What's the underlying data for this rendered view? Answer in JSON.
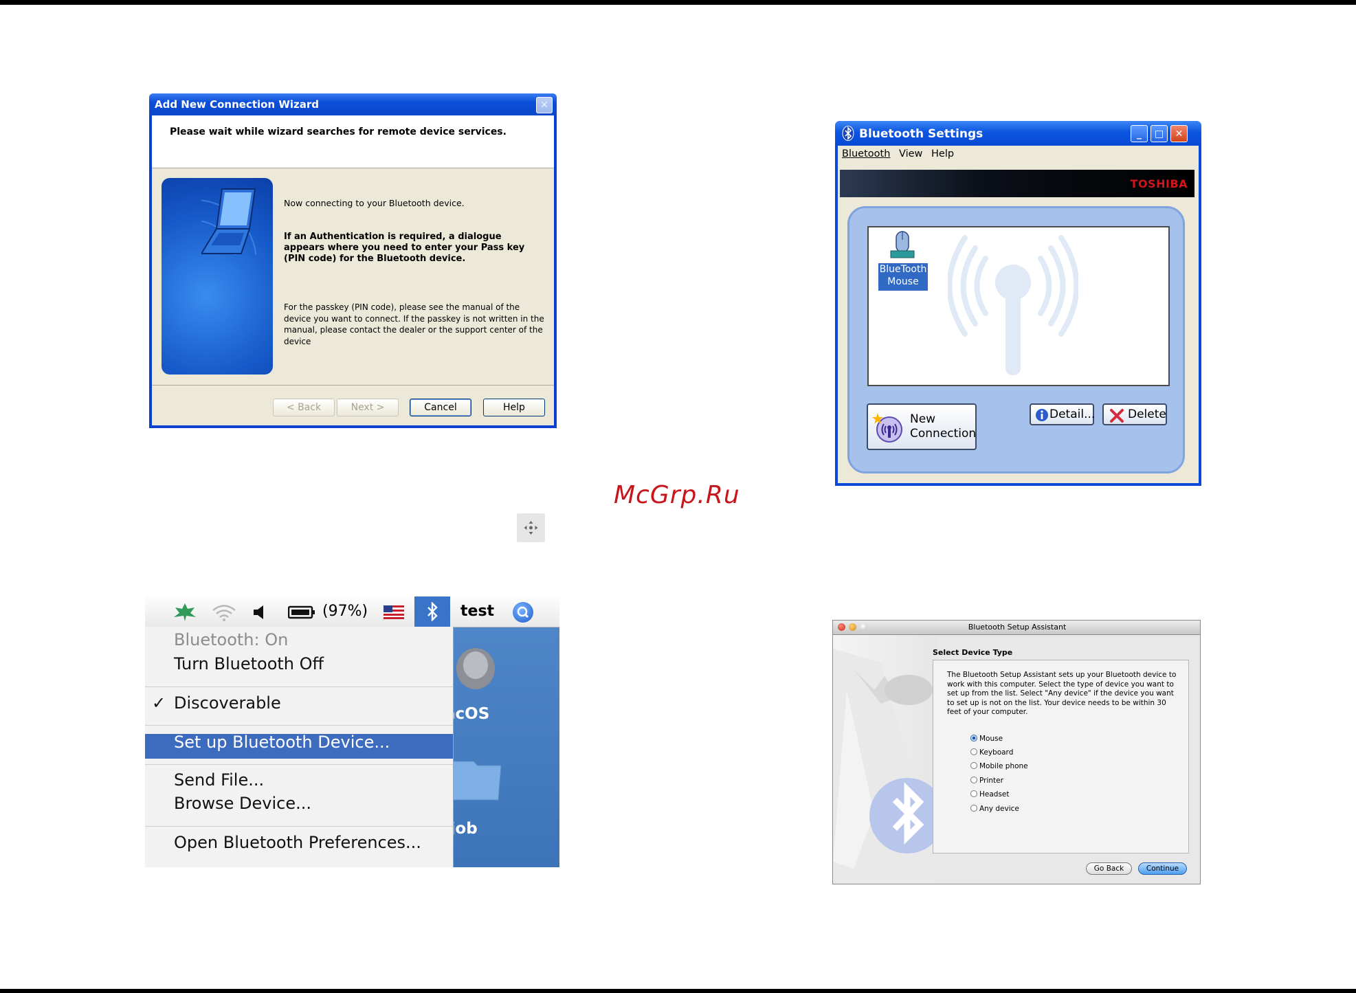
{
  "watermark": "McGrp.Ru",
  "wizard": {
    "title": "Add New Connection Wizard",
    "header": "Please wait while wizard searches for remote device services.",
    "line1": "Now connecting to your Bluetooth device.",
    "line2": "If an Authentication is required, a dialogue appears where you need to enter your Pass key (PIN code) for the Bluetooth device.",
    "line3": "For the passkey (PIN code), please see the manual of the device you want to connect. If the passkey is not written in the manual, please contact the dealer or the support center of the device",
    "buttons": {
      "back": "< Back",
      "next": "Next >",
      "cancel": "Cancel",
      "help": "Help"
    }
  },
  "bt_settings": {
    "title": "Bluetooth Settings",
    "menu": [
      "Bluetooth",
      "View",
      "Help"
    ],
    "brand": "TOSHIBA",
    "device_label_1": "BlueTooth",
    "device_label_2": "Mouse",
    "new_connection_1": "New",
    "new_connection_2": "Connection",
    "detail": "Detail...",
    "delete": "Delete"
  },
  "mac_menu": {
    "menubar": {
      "battery": "(97%)",
      "user": "test"
    },
    "items": {
      "status": "Bluetooth: On",
      "turn_off": "Turn Bluetooth Off",
      "discoverable": "Discoverable",
      "check": "✓",
      "setup": "Set up Bluetooth Device...",
      "send": "Send File...",
      "browse": "Browse Device...",
      "prefs": "Open Bluetooth Preferences..."
    },
    "desktop": {
      "disk": "acOS",
      "folder": "a job"
    }
  },
  "setup_assistant": {
    "title": "Bluetooth Setup Assistant",
    "heading": "Select Device Type",
    "paragraph": "The Bluetooth Setup Assistant sets up your Bluetooth device to work with this computer. Select the type of device you want to set up from the list. Select \"Any device\" if the device you want to set up is not on the list. Your device needs to be within 30 feet of your computer.",
    "options": [
      "Mouse",
      "Keyboard",
      "Mobile phone",
      "Printer",
      "Headset",
      "Any device"
    ],
    "selected": "Mouse",
    "go_back": "Go Back",
    "continue": "Continue"
  },
  "colors": {
    "xp_blue": "#0a48d8",
    "mac_highlight": "#3d6bbd",
    "watermark": "#c8151b",
    "toshiba_red": "#d4141c"
  }
}
